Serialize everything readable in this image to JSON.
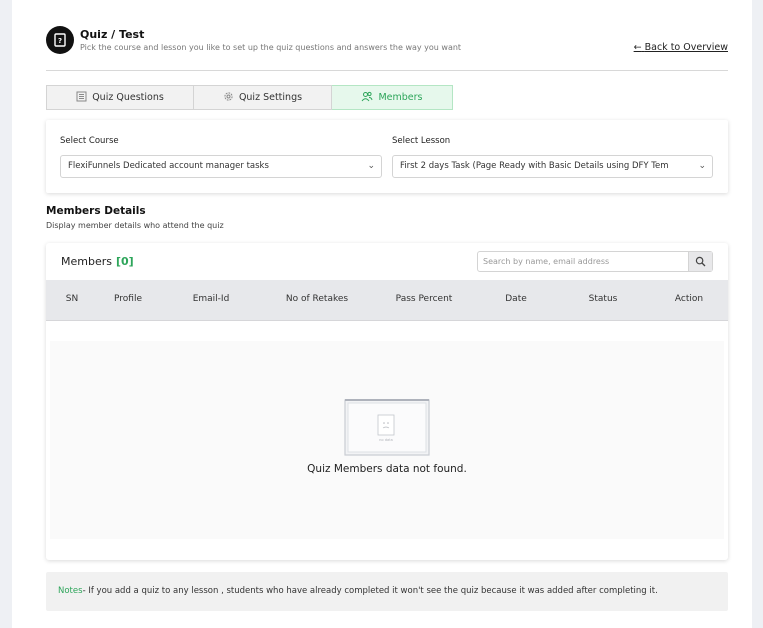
{
  "header": {
    "title": "Quiz / Test",
    "subtitle": "Pick the course and lesson you like to set up the quiz questions and answers the way you want",
    "back_link": "Back to Overview"
  },
  "tabs": [
    {
      "label": "Quiz Questions",
      "icon": "list-icon",
      "active": false
    },
    {
      "label": "Quiz Settings",
      "icon": "gear-icon",
      "active": false
    },
    {
      "label": "Members",
      "icon": "users-icon",
      "active": true
    }
  ],
  "course_select": {
    "label": "Select Course",
    "value": "FlexiFunnels Dedicated account manager tasks"
  },
  "lesson_select": {
    "label": "Select Lesson",
    "value": "First 2 days Task (Page Ready with Basic Details using DFY Tem"
  },
  "members_section": {
    "title": "Members Details",
    "subtitle": "Display member details who attend the quiz"
  },
  "members_table": {
    "label": "Members",
    "count": "[0]",
    "search_placeholder": "Search by name, email address",
    "columns": [
      "SN",
      "Profile",
      "Email-Id",
      "No of Retakes",
      "Pass Percent",
      "Date",
      "Status",
      "Action"
    ],
    "rows": [],
    "empty_illustration_text": "no data",
    "empty_message": "Quiz Members data not found."
  },
  "notes": {
    "label": "Notes",
    "text": "- If you add a quiz to any lesson , students who have already completed it won't see the quiz because it was added after completing it."
  },
  "colors": {
    "accent_green": "#2da55a",
    "active_tab_bg": "#e6f8ec",
    "table_header_bg": "#e7e8eb"
  }
}
